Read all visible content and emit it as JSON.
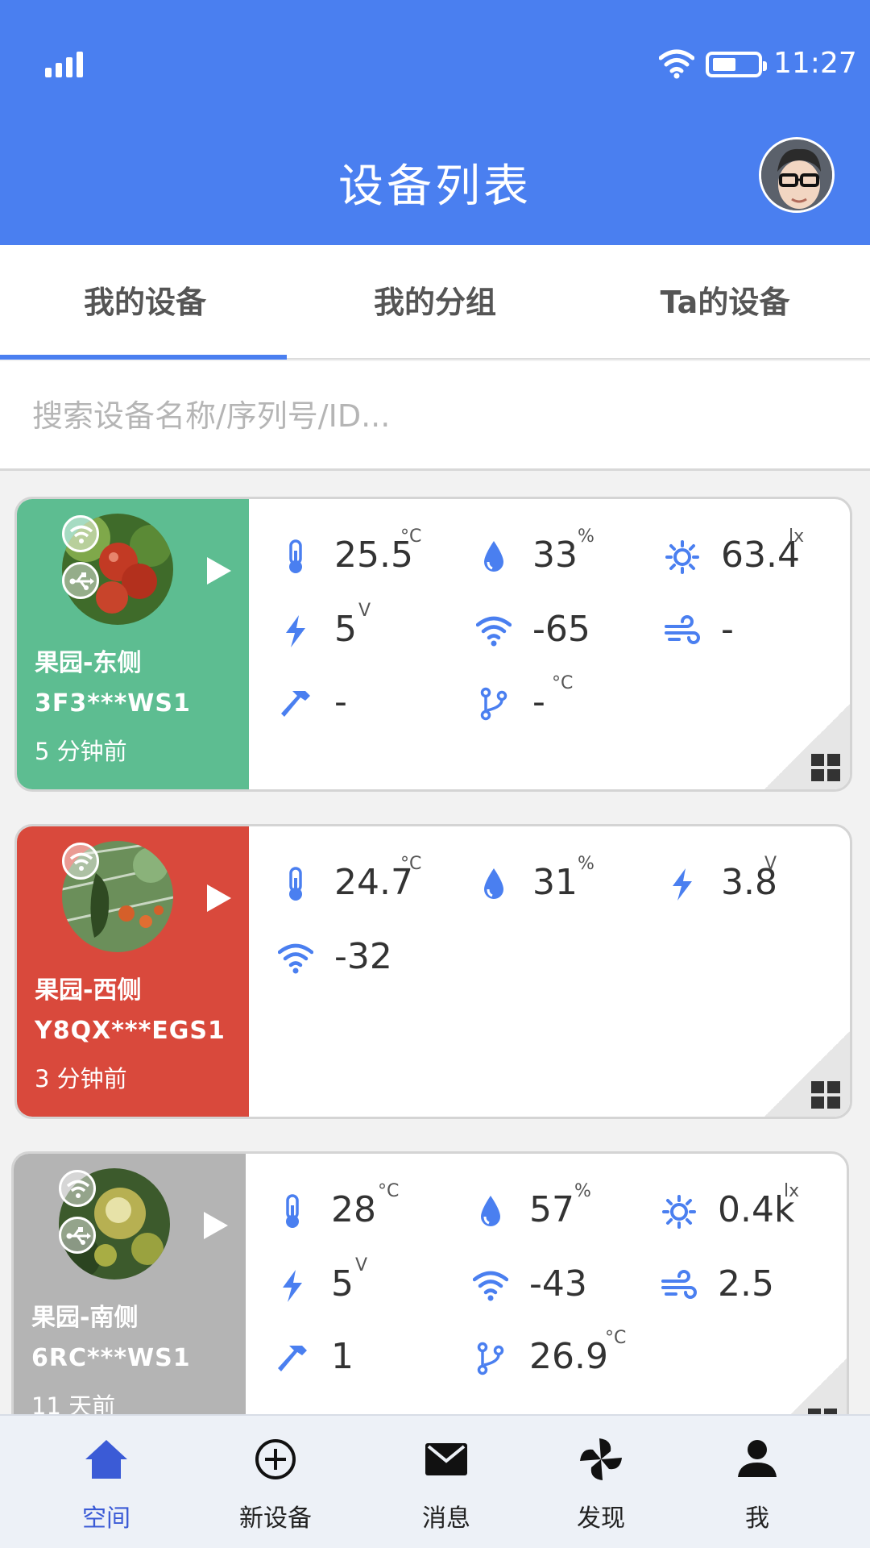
{
  "status_bar": {
    "time": "11:27"
  },
  "header": {
    "title": "设备列表"
  },
  "tabs": [
    {
      "label": "我的设备",
      "active": true
    },
    {
      "label": "我的分组",
      "active": false
    },
    {
      "label": "Ta的设备",
      "active": false
    }
  ],
  "search": {
    "placeholder": "搜索设备名称/序列号/ID...",
    "value": ""
  },
  "devices": [
    {
      "name": "果园-东侧",
      "serial": "3F3***WS1",
      "updated": "5 分钟前",
      "status_color": "#5dbd91",
      "readings": {
        "temperature": {
          "value": "25.5",
          "unit": "°C"
        },
        "humidity": {
          "value": "33",
          "unit": "%"
        },
        "light": {
          "value": "63.4",
          "unit": "lx"
        },
        "voltage": {
          "value": "5",
          "unit": "V"
        },
        "signal": {
          "value": "-65"
        },
        "wind": {
          "value": "-"
        },
        "hammer": {
          "value": "-"
        },
        "probe": {
          "value": "-",
          "unit": "°C"
        }
      }
    },
    {
      "name": "果园-西侧",
      "serial": "Y8QX***EGS1",
      "updated": "3 分钟前",
      "status_color": "#d9493c",
      "readings": {
        "temperature": {
          "value": "24.7",
          "unit": "°C"
        },
        "humidity": {
          "value": "31",
          "unit": "%"
        },
        "voltage": {
          "value": "3.8",
          "unit": "V"
        },
        "signal": {
          "value": "-32"
        }
      }
    },
    {
      "name": "果园-南侧",
      "serial": "6RC***WS1",
      "updated": "11 天前",
      "status_color": "#b4b4b4",
      "readings": {
        "temperature": {
          "value": "28",
          "unit": "°C"
        },
        "humidity": {
          "value": "57",
          "unit": "%"
        },
        "light": {
          "value": "0.4k",
          "unit": "lx"
        },
        "voltage": {
          "value": "5",
          "unit": "V"
        },
        "signal": {
          "value": "-43"
        },
        "wind": {
          "value": "2.5"
        },
        "hammer": {
          "value": "1"
        },
        "probe": {
          "value": "26.9",
          "unit": "°C"
        }
      }
    }
  ],
  "bottom_nav": [
    {
      "label": "空间",
      "icon": "home-icon",
      "active": true
    },
    {
      "label": "新设备",
      "icon": "add-circle-icon",
      "active": false
    },
    {
      "label": "消息",
      "icon": "mail-icon",
      "active": false
    },
    {
      "label": "发现",
      "icon": "pinwheel-icon",
      "active": false
    },
    {
      "label": "我",
      "icon": "person-icon",
      "active": false
    }
  ],
  "colors": {
    "primary": "#4a7ff0",
    "icon_blue": "#4a7ff0",
    "active_nav": "#3b5bd6"
  }
}
